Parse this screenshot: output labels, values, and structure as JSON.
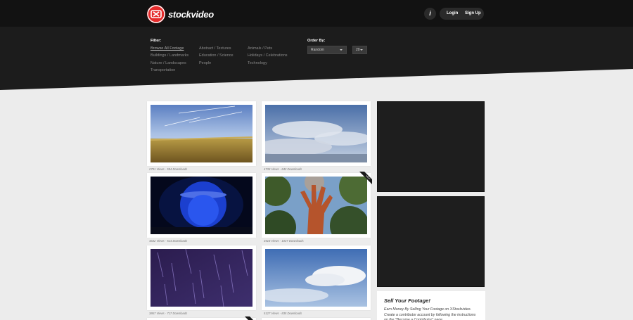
{
  "header": {
    "brand": "stockvideo",
    "info_label": "i",
    "login_label": "Login",
    "signup_label": "Sign Up"
  },
  "filter": {
    "title": "Filter:",
    "categories": [
      "Browse All Footage",
      "Abstract / Textures",
      "Animals / Pets",
      "Buildings / Landmarks",
      "Education / Science",
      "Holidays / Celebrations",
      "Nature / Landscapes",
      "People",
      "Technology",
      "Transportation"
    ]
  },
  "order": {
    "title": "Order By:",
    "sort_value": "Random",
    "count_value": "20"
  },
  "cards": [
    {
      "views": "2791",
      "downloads": "594"
    },
    {
      "views": "4733",
      "downloads": "842"
    },
    {
      "views": "4632",
      "downloads": "514"
    },
    {
      "views": "3518",
      "downloads": "1037"
    },
    {
      "views": "3867",
      "downloads": "717"
    },
    {
      "views": "5127",
      "downloads": "835"
    }
  ],
  "labels": {
    "views": "Views",
    "separator": "·",
    "downloads": "Downloads",
    "ribbon": "NEW"
  },
  "sell": {
    "title": "Sell Your Footage!",
    "body": "Earn Money By Selling Your Footage on XStockvideo. Create a contributor account by following the instructions on the \"Become a Contributor\" page."
  },
  "colors": {
    "header_bg": "#121212",
    "panel_bg": "#1c1c1c",
    "page_bg": "#ececec",
    "brand_red": "#e52b2b",
    "ad_bg": "#1e1e1e"
  }
}
